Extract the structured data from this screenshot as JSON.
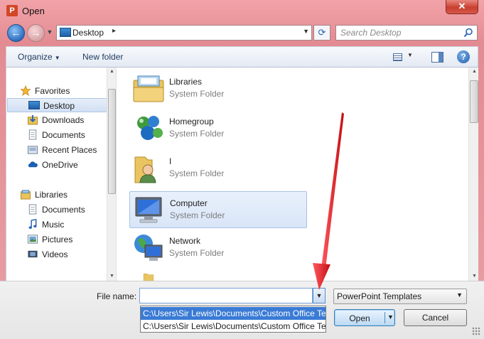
{
  "window": {
    "title": "Open",
    "app_icon_letter": "P",
    "close_glyph": "✕"
  },
  "nav": {
    "back_glyph": "←",
    "forward_glyph": "→",
    "address": {
      "location": "Desktop",
      "separator": "▸",
      "dropdown_glyph": "▼"
    },
    "refresh_glyph": "⟳",
    "search": {
      "placeholder": "Search Desktop",
      "icon": "search-icon"
    }
  },
  "toolbar": {
    "organize_label": "Organize",
    "new_folder_label": "New folder",
    "caret": "▼",
    "help_glyph": "?"
  },
  "navpane": {
    "favorites": {
      "label": "Favorites",
      "items": [
        "Desktop",
        "Downloads",
        "Documents",
        "Recent Places",
        "OneDrive"
      ],
      "selected": "Desktop"
    },
    "libraries": {
      "label": "Libraries",
      "items": [
        "Documents",
        "Music",
        "Pictures",
        "Videos"
      ]
    }
  },
  "files": [
    {
      "name": "Libraries",
      "type": "System Folder",
      "icon": "libraries-icon",
      "selected": false
    },
    {
      "name": "Homegroup",
      "type": "System Folder",
      "icon": "homegroup-icon",
      "selected": false
    },
    {
      "name": "I",
      "type": "System Folder",
      "icon": "user-folder-icon",
      "selected": false
    },
    {
      "name": "Computer",
      "type": "System Folder",
      "icon": "computer-icon",
      "selected": true
    },
    {
      "name": "Network",
      "type": "System Folder",
      "icon": "network-icon",
      "selected": false
    }
  ],
  "bottom": {
    "file_name_label": "File name:",
    "file_name_value": "",
    "autocomplete": [
      "C:\\Users\\Sir Lewis\\Documents\\Custom Office Te",
      "C:\\Users\\Sir Lewis\\Documents\\Custom Office Te"
    ],
    "file_type": "PowerPoint Templates",
    "open_label": "Open",
    "cancel_label": "Cancel",
    "dd_glyph": "▼"
  },
  "colors": {
    "accent_arrow": "#e3151b",
    "selection_blue": "#3a7bd5",
    "chrome_pink": "#e38b92"
  }
}
